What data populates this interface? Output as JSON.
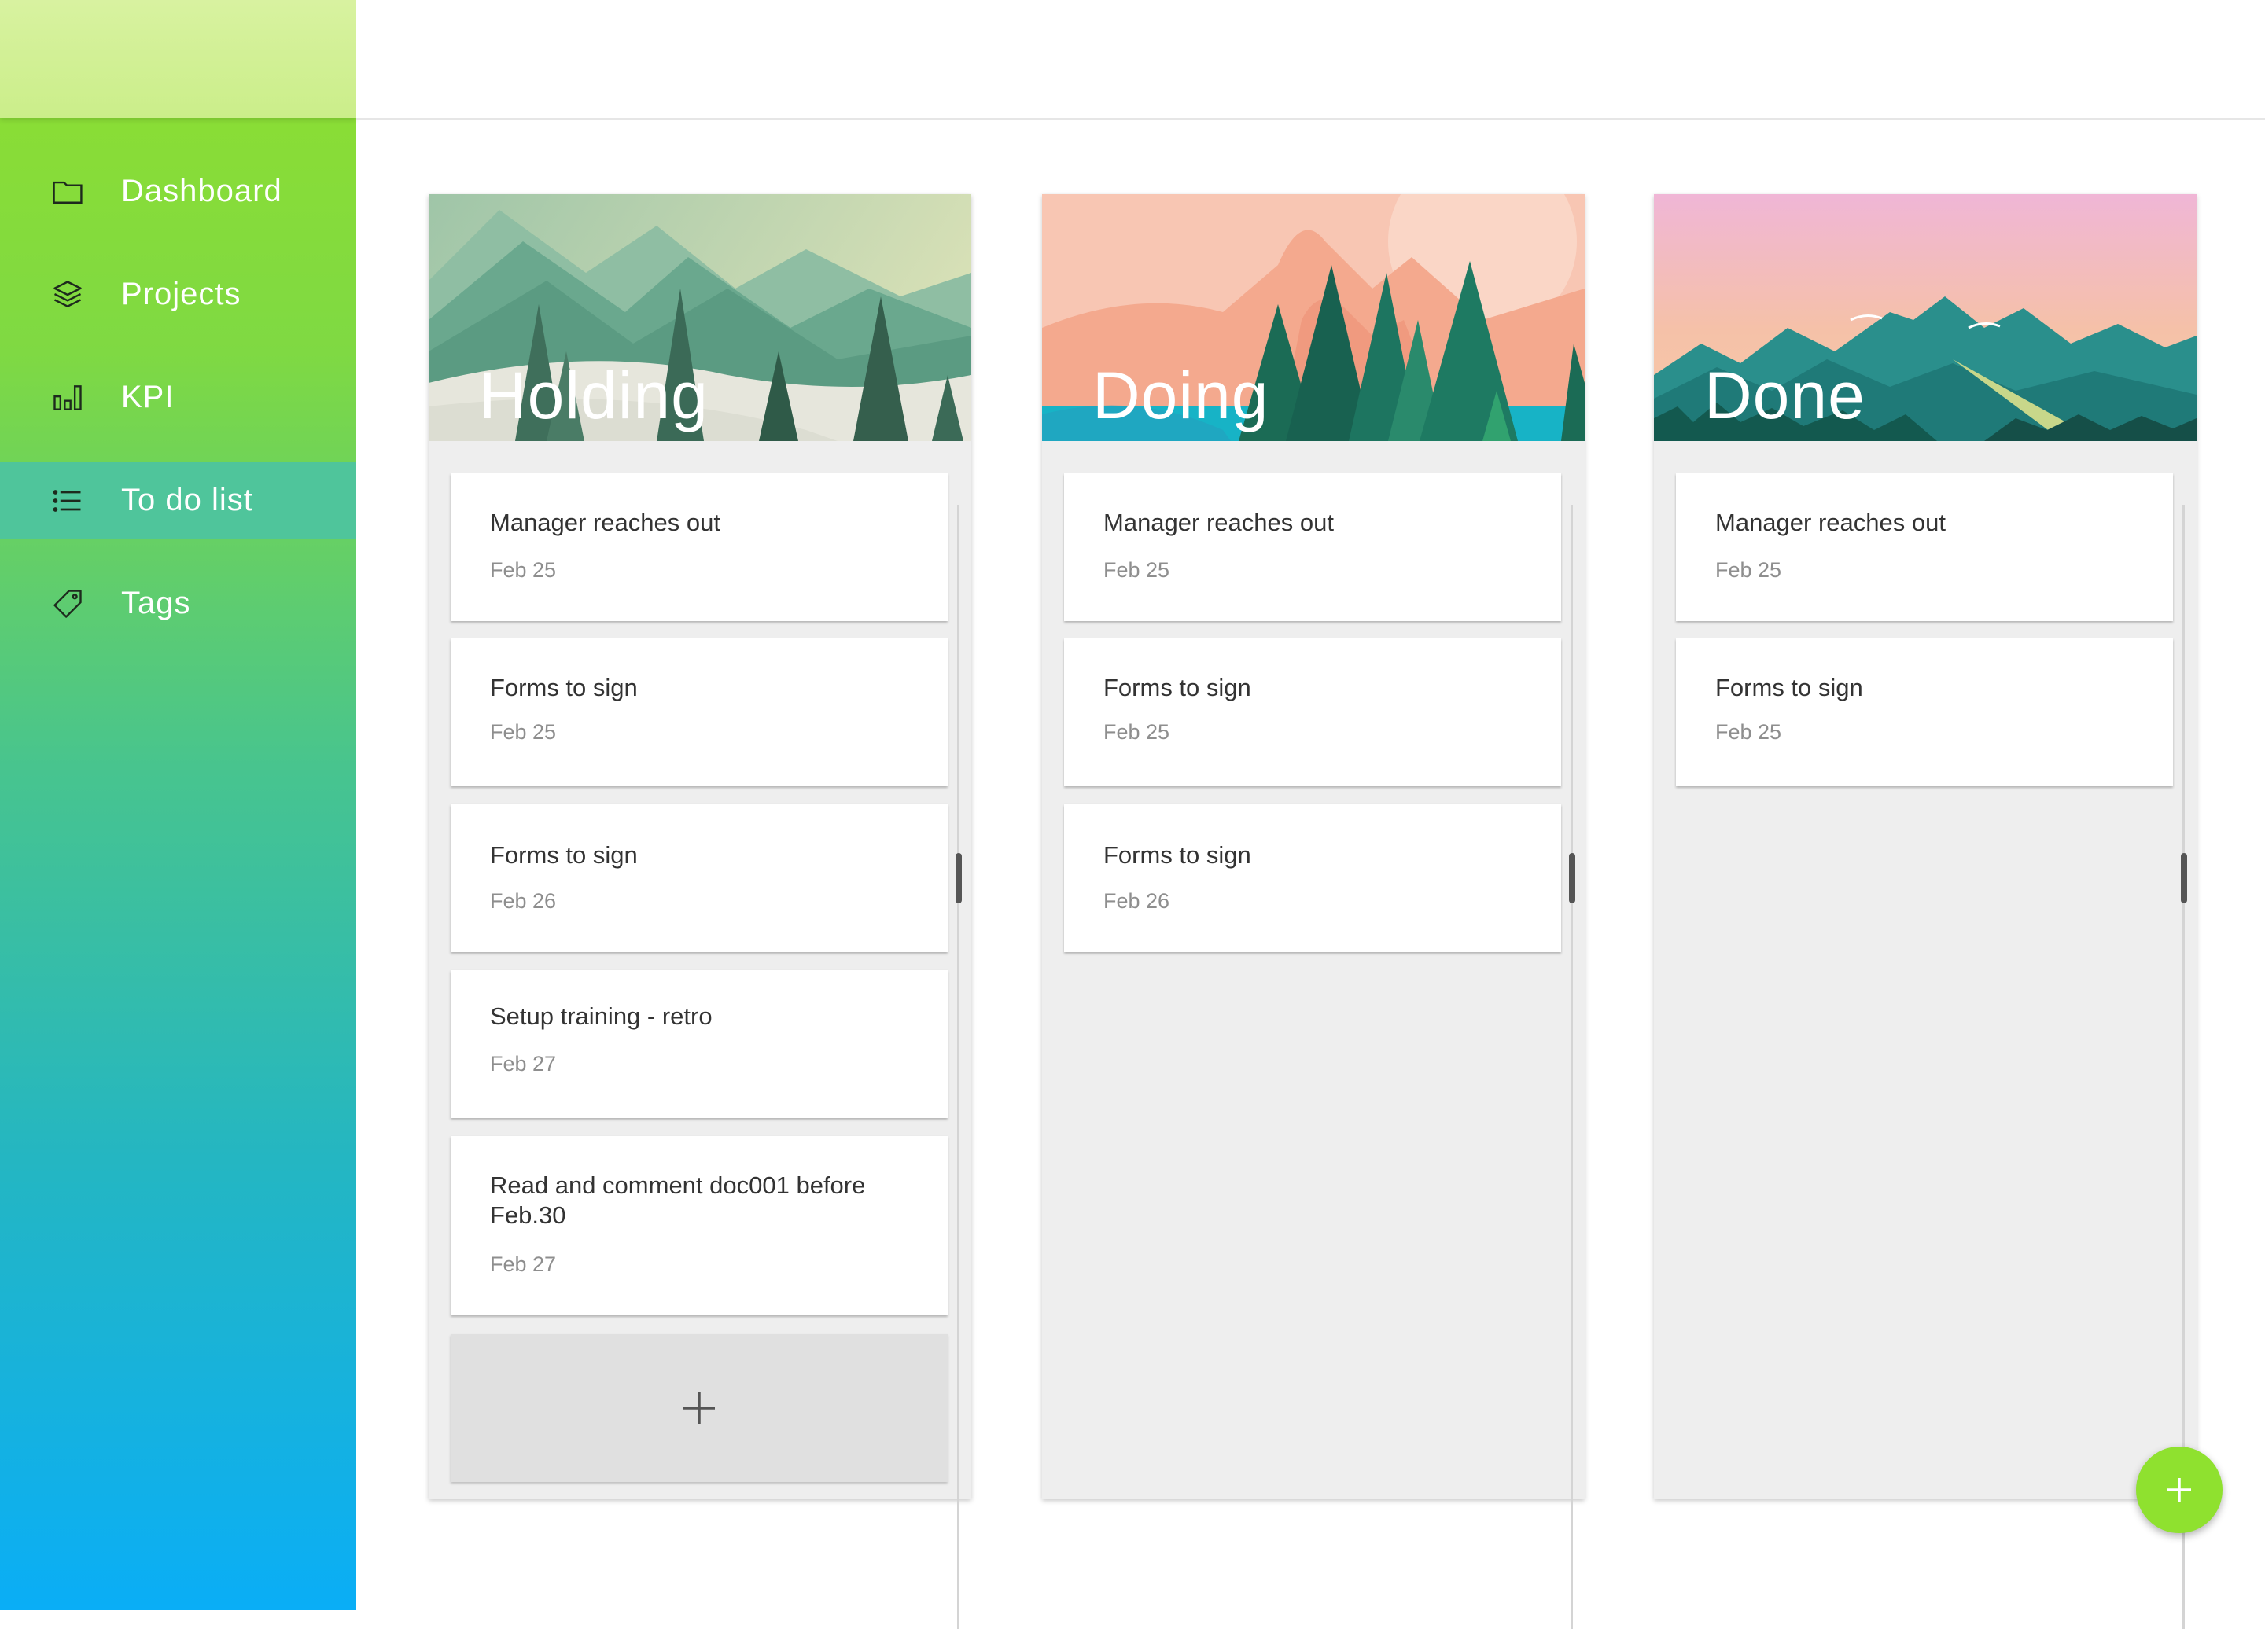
{
  "sidebar": {
    "items": [
      {
        "label": "Dashboard",
        "icon": "folder-icon",
        "active": false
      },
      {
        "label": "Projects",
        "icon": "layers-icon",
        "active": false
      },
      {
        "label": "KPI",
        "icon": "bar-chart-icon",
        "active": false
      },
      {
        "label": "To do list",
        "icon": "list-icon",
        "active": true
      },
      {
        "label": "Tags",
        "icon": "tag-icon",
        "active": false
      }
    ]
  },
  "board": {
    "columns": [
      {
        "title": "Holding",
        "cards": [
          {
            "title": "Manager reaches out",
            "date": "Feb 25"
          },
          {
            "title": "Forms to sign",
            "date": "Feb 25"
          },
          {
            "title": "Forms to sign",
            "date": "Feb 26"
          },
          {
            "title": "Setup training - retro",
            "date": "Feb 27"
          },
          {
            "title": "Read and comment doc001 before Feb.30",
            "date": "Feb 27"
          }
        ],
        "add_card": "+"
      },
      {
        "title": "Doing",
        "cards": [
          {
            "title": "Manager reaches out",
            "date": "Feb 25"
          },
          {
            "title": "Forms to sign",
            "date": "Feb 25"
          },
          {
            "title": "Forms to sign",
            "date": "Feb 26"
          }
        ]
      },
      {
        "title": "Done",
        "cards": [
          {
            "title": "Manager reaches out",
            "date": "Feb 25"
          },
          {
            "title": "Forms to sign",
            "date": "Feb 25"
          }
        ]
      }
    ]
  },
  "fab": {
    "icon": "plus-icon"
  },
  "colors": {
    "accent": "#8fe12f",
    "sidebar_active": "#4fc59b",
    "sidebar_gradient_top": "#8fdf2f",
    "sidebar_gradient_bottom": "#0aaef6"
  }
}
